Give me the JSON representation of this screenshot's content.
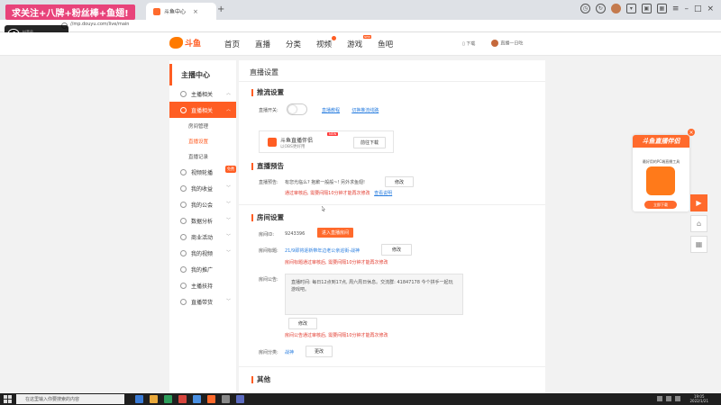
{
  "overlay": {
    "promo_text": "求关注+八牌+粉丝棒+鱼翅!",
    "tiktok_label": "抖音号",
    "tiktok_id": "360818940"
  },
  "browser": {
    "tabs": [
      {
        "label": "",
        "color": "#3b78e7"
      },
      {
        "label": "斗鱼中心",
        "color": "#ff6a2c"
      }
    ],
    "url": "//mp.douyu.com/live/main"
  },
  "site": {
    "logo_name": "斗鱼",
    "nav": [
      "首页",
      "直播",
      "分类",
      "视频",
      "游戏",
      "鱼吧"
    ],
    "nav_new_badge": "NEW",
    "download": "下载",
    "user": "直播一日吃"
  },
  "sidebar": {
    "title": "主播中心",
    "items": [
      {
        "label": "主播相关"
      },
      {
        "label": "直播相关"
      },
      {
        "label": "视频轮播"
      },
      {
        "label": "我的收益"
      },
      {
        "label": "我的公会"
      },
      {
        "label": "数据分析"
      },
      {
        "label": "商业活动"
      },
      {
        "label": "我的视频"
      },
      {
        "label": "我的推广"
      },
      {
        "label": "主播扶持"
      },
      {
        "label": "直播带货"
      }
    ],
    "subitems": [
      "房间管理",
      "直播设置",
      "直播记录"
    ],
    "hot_badge": "免费"
  },
  "main": {
    "page_title": "直播设置",
    "push": {
      "section": "推流设置",
      "switch_label": "直播开关:",
      "links": [
        "直播教程",
        "切换推流线路"
      ],
      "companion_name": "斗鱼直播伴侣",
      "companion_sub": "以OBS更好用",
      "companion_badge": "NEW",
      "companion_btn": "前往下载"
    },
    "notice": {
      "section": "直播预告",
      "label": "直播预告:",
      "text": "有您光临么? 抱歉一般般~! 另外求鱼翅!",
      "edit_btn": "修改",
      "warn": "通过审核后, 需要间隔10分钟才能再次修改",
      "warn_link": "查看说明"
    },
    "room": {
      "section": "房间设置",
      "id_label": "房间ID:",
      "id_value": "9243396",
      "enter_btn": "进入直播房间",
      "title_label": "房间标题:",
      "title_value": "21/9即将逐新带年边老公亲巡街-战神",
      "title_btn": "修改",
      "title_warn": "房间标题通过审核后, 需要间隔10分钟才能再次修改",
      "announce_label": "房间公告:",
      "announce_text": "直播时间: 每日12点到17点, 周六周日休息。交流群: 41847178 今个拼手一起玩游戏吧。",
      "announce_btn": "修改",
      "announce_warn": "房间公告通过审核后, 需要间隔10分钟才能再次修改",
      "category_label": "房间分类:",
      "category_value": "战神",
      "category_btn": "更改"
    },
    "other": {
      "section": "其他"
    }
  },
  "widget": {
    "title": "斗鱼直播伴侣",
    "desc": "最好用的PC端直播工具",
    "btn": "立即下载"
  },
  "taskbar": {
    "search_placeholder": "在这里输入你要搜索的内容",
    "time": "19:05",
    "date": "2022/1/21"
  },
  "colors": {
    "accent": "#ff5d23",
    "promo": "#e8437a",
    "warn": "#e23c2f",
    "link": "#2b7fe0"
  }
}
